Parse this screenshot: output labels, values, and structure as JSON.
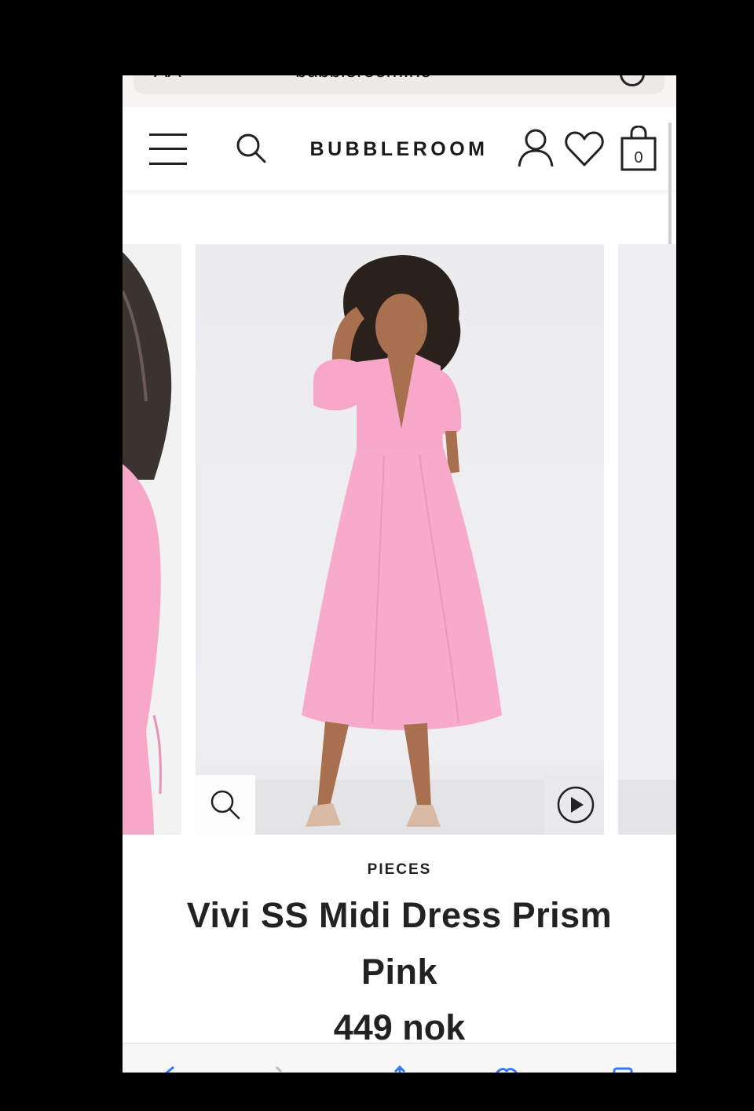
{
  "browser": {
    "address_prefix": "AA",
    "url": "bubbleroom.no"
  },
  "header": {
    "logo": "BUBBLEROOM",
    "cart_count": "0",
    "icons": [
      "menu-icon",
      "search-icon",
      "account-icon",
      "heart-icon",
      "shopping-bag-icon"
    ]
  },
  "gallery": {
    "controls": [
      "zoom-icon",
      "play-icon"
    ],
    "dress_color": "#f8a9cb"
  },
  "product": {
    "brand": "PIECES",
    "title": "Vivi SS Midi Dress Prism Pink",
    "price": "449 nok"
  },
  "toolbar": {
    "icons": [
      "back-icon",
      "forward-icon",
      "share-icon",
      "bookmarks-icon",
      "tabs-icon"
    ]
  }
}
